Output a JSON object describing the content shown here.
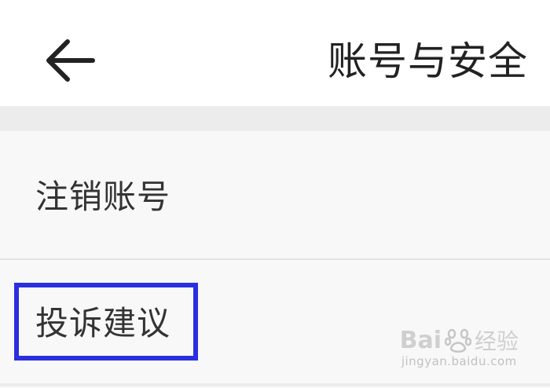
{
  "header": {
    "back_icon": "arrow-left-icon",
    "title": "账号与安全"
  },
  "list": {
    "items": [
      {
        "label": "注销账号"
      },
      {
        "label": "投诉建议",
        "highlighted": true
      }
    ]
  },
  "watermark": {
    "brand": "Bai",
    "suffix": "经验",
    "url": "jingyan.baidu.com"
  },
  "colors": {
    "highlight_border": "#2a2fe0",
    "background": "#f8f8f8",
    "separator": "#ececec"
  }
}
